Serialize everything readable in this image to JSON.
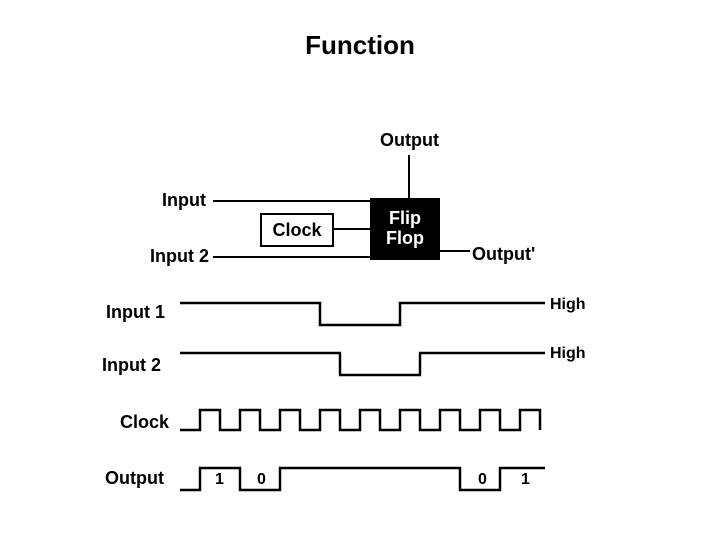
{
  "title": "Function",
  "schematic": {
    "input_top": "Input",
    "input_bottom": "Input 2",
    "clock_label": "Clock",
    "block_label_line1": "Flip",
    "block_label_line2": "Flop",
    "output_label": "Output",
    "output_prime_label": "Output'"
  },
  "timing": {
    "rows": {
      "input1": "Input 1",
      "input2": "Input 2",
      "clock": "Clock",
      "output": "Output"
    },
    "high_label_1": "High",
    "high_label_2": "High",
    "output_values": {
      "a": "1",
      "b": "0",
      "c": "0",
      "d": "1"
    }
  },
  "chart_data": [
    {
      "type": "line",
      "title": "Input 1",
      "signal_levels": [
        "high",
        "low",
        "high"
      ],
      "transitions_x_approx": [
        0.36,
        0.56
      ],
      "ylabel": "",
      "xlabel": ""
    },
    {
      "type": "line",
      "title": "Input 2",
      "signal_levels": [
        "high",
        "low",
        "high"
      ],
      "transitions_x_approx": [
        0.4,
        0.6
      ],
      "ylabel": "",
      "xlabel": ""
    },
    {
      "type": "line",
      "title": "Clock",
      "signal": "square_wave",
      "periods_visible": 9,
      "ylabel": "",
      "xlabel": ""
    },
    {
      "type": "line",
      "title": "Output",
      "labeled_states": [
        "1",
        "0",
        "",
        "0",
        "1"
      ],
      "ylabel": "",
      "xlabel": ""
    }
  ]
}
